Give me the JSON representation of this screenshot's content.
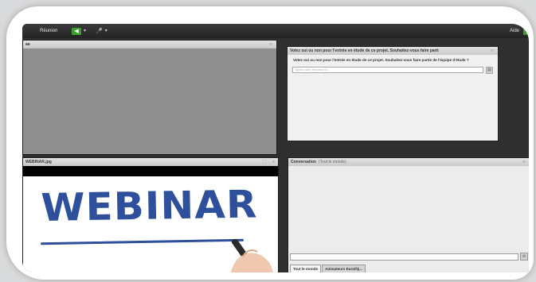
{
  "toolbar": {
    "meeting_label": "Réunion",
    "speaker_icon": "speaker-icon",
    "mic_icon": "microphone-icon",
    "help_label": "Aide"
  },
  "video_panel": {
    "title": "aa",
    "options_icon": "options-icon"
  },
  "poll_panel": {
    "title": "Votez oui ou non pour l'entrée en étude de ce projet. Souhaitez-vous faire parti",
    "question": "Votez oui ou non pour l'entrée en étude de ce projet. Souhaitez-vous faire partie de l'équipe d'étude ?",
    "input_placeholder": "Tapez votre réponse ici...",
    "send_icon": "send-icon"
  },
  "doc_panel": {
    "title": "WEBINAR.jpg",
    "image_text": "WEBINAR",
    "fit_icon": "fit-to-window-icon"
  },
  "chat_panel": {
    "title": "Conversation",
    "subtitle": "(Tout le monde)",
    "tabs": [
      {
        "label": "Tout le monde"
      },
      {
        "label": "Animateurs Eurol/Q..."
      }
    ],
    "send_icon": "send-icon"
  },
  "colors": {
    "accent_green": "#3aa12a",
    "webinar_blue": "#2d4f9c"
  }
}
